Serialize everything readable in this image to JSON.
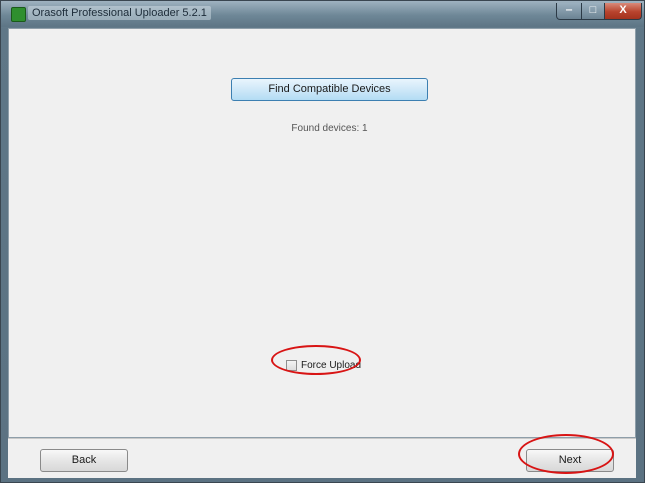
{
  "window": {
    "title": "Orasoft Professional Uploader 5.2.1",
    "controls": {
      "minimize": "‒",
      "maximize": "□",
      "close": "X"
    }
  },
  "main": {
    "find_button_label": "Find Compatible Devices",
    "found_devices_text": "Found devices: 1",
    "force_upload_label": "Force Upload",
    "force_upload_checked": false
  },
  "footer": {
    "back_label": "Back",
    "next_label": "Next"
  },
  "annotations": {
    "highlight_color": "#d81414",
    "highlighted_items": [
      "force-upload-checkbox",
      "next-button"
    ]
  },
  "colors": {
    "titlebar": "#6e8797",
    "close_button": "#b8432d",
    "accent_button": "#cfe8f8"
  }
}
